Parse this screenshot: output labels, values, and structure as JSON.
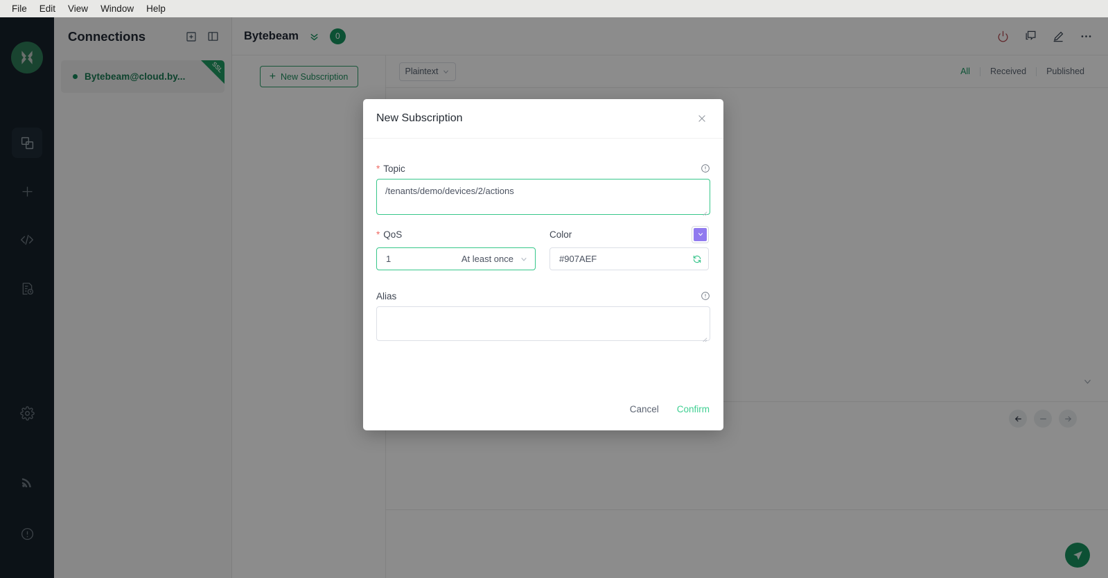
{
  "menubar": {
    "items": [
      "File",
      "Edit",
      "View",
      "Window",
      "Help"
    ]
  },
  "rail": {
    "logo_name": "mqttx-logo",
    "items": [
      {
        "name": "connections-icon",
        "active": true
      },
      {
        "name": "new-connection-icon",
        "active": false
      },
      {
        "name": "script-icon",
        "active": false
      },
      {
        "name": "log-icon",
        "active": false
      },
      {
        "name": "settings-icon",
        "active": false
      },
      {
        "name": "broadcast-icon",
        "active": false
      },
      {
        "name": "about-icon",
        "active": false
      }
    ]
  },
  "connections_panel": {
    "title": "Connections",
    "add_icon": "add-square-icon",
    "layout_icon": "panel-toggle-icon",
    "items": [
      {
        "name": "Bytebeam@cloud.by...",
        "badge": "SSL",
        "status": "connected"
      }
    ]
  },
  "main_header": {
    "title": "Bytebeam",
    "chevron_icon": "double-chevron-down-icon",
    "badge": "0",
    "actions": [
      {
        "name": "disconnect-icon",
        "label": "power"
      },
      {
        "name": "message-icon",
        "label": "messages"
      },
      {
        "name": "edit-icon",
        "label": "edit"
      },
      {
        "name": "more-icon",
        "label": "more"
      }
    ]
  },
  "subscriptions": {
    "new_button_label": "New Subscription",
    "new_button_icon": "plus-icon"
  },
  "messages_toolbar": {
    "format": "Plaintext",
    "format_caret": "chevron-down-icon",
    "tabs": [
      {
        "label": "All",
        "active": true
      },
      {
        "label": "Received",
        "active": false
      },
      {
        "label": "Published",
        "active": false
      }
    ]
  },
  "pager": {
    "prev_icon": "arrow-left-icon",
    "mid_icon": "dash-icon",
    "next_icon": "arrow-right-icon"
  },
  "composer": {
    "send_icon": "send-icon"
  },
  "modal": {
    "title": "New Subscription",
    "close_icon": "close-icon",
    "topic": {
      "label": "Topic",
      "required": true,
      "value": "/tenants/demo/devices/2/actions",
      "info_icon": "info-circle-icon"
    },
    "qos": {
      "label": "QoS",
      "required": true,
      "value": "1",
      "description": "At least once",
      "caret_icon": "chevron-down-icon"
    },
    "color": {
      "label": "Color",
      "value": "#907AEF",
      "swatch_color": "#907AEF",
      "swatch_icon": "chevron-down-icon",
      "refresh_icon": "refresh-icon"
    },
    "alias": {
      "label": "Alias",
      "value": "",
      "info_icon": "info-circle-icon"
    },
    "cancel_label": "Cancel",
    "confirm_label": "Confirm"
  },
  "colors": {
    "accent_green": "#17945f",
    "confirm_green": "#3fcf92",
    "border_green": "#37c78a",
    "swatch_purple": "#907AEF",
    "required_red": "#f06a64",
    "rail_bg": "#17212b"
  }
}
